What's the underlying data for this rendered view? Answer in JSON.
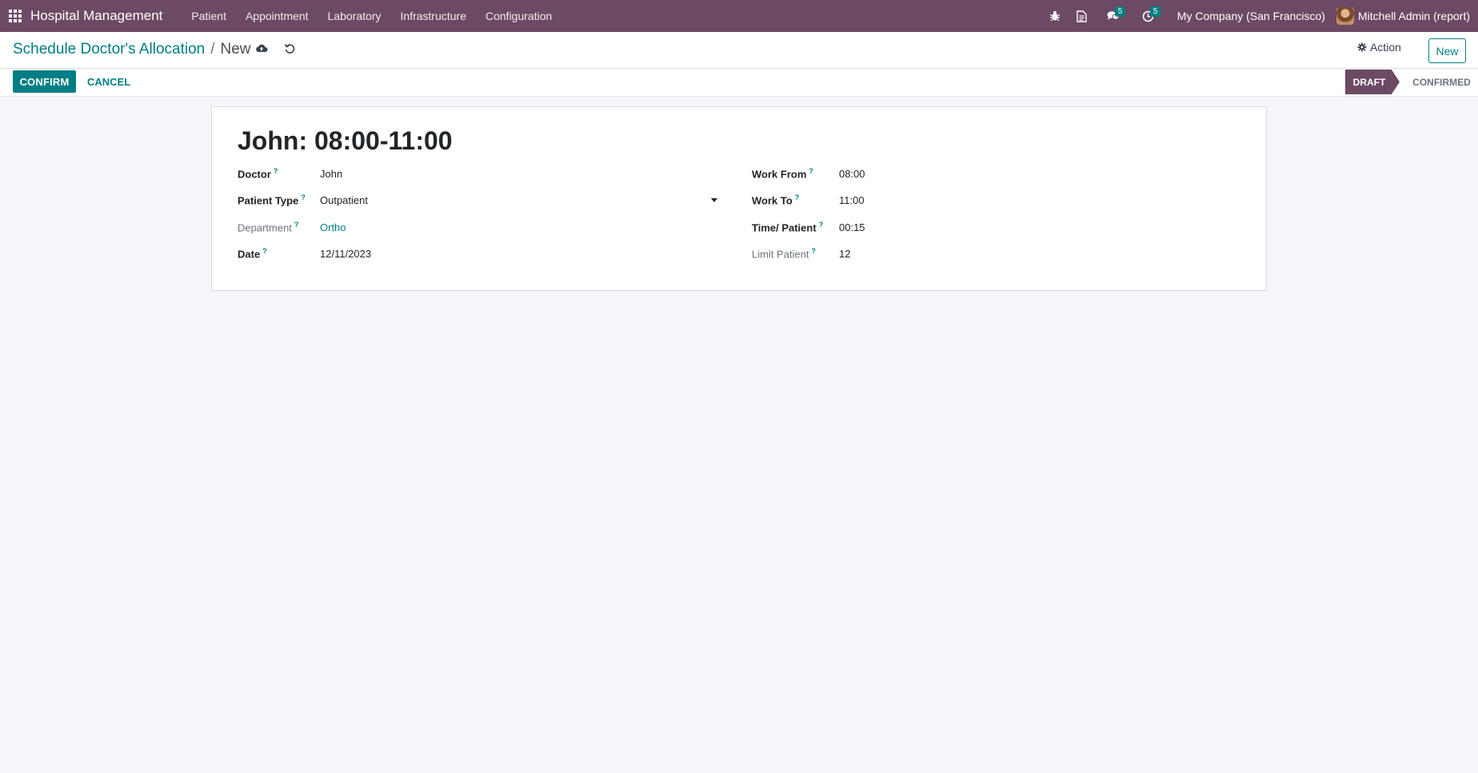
{
  "navbar": {
    "app_name": "Hospital Management",
    "menu": [
      "Patient",
      "Appointment",
      "Laboratory",
      "Infrastructure",
      "Configuration"
    ],
    "messages_count": "5",
    "activities_count": "5",
    "company": "My Company (San Francisco)",
    "user": "Mitchell Admin (report)"
  },
  "breadcrumb": {
    "parent": "Schedule Doctor's Allocation",
    "separator": "/",
    "current": "New"
  },
  "control": {
    "action_label": "Action",
    "new_label": "New"
  },
  "statusbar": {
    "confirm_label": "CONFIRM",
    "cancel_label": "CANCEL",
    "stages": [
      "DRAFT",
      "CONFIRMED"
    ],
    "active_stage": "DRAFT"
  },
  "form": {
    "title": "John: 08:00-11:00",
    "help_mark": "?",
    "left": [
      {
        "label": "Doctor",
        "value": "John"
      },
      {
        "label": "Patient Type",
        "value": "Outpatient"
      },
      {
        "label": "Department",
        "value": "Ortho"
      },
      {
        "label": "Date",
        "value": "12/11/2023"
      }
    ],
    "right": [
      {
        "label": "Work From",
        "value": "08:00"
      },
      {
        "label": "Work To",
        "value": "11:00"
      },
      {
        "label": "Time/ Patient",
        "value": "00:15"
      },
      {
        "label": "Limit Patient",
        "value": "12"
      }
    ]
  },
  "colors": {
    "navbar": "#6c4a63",
    "accent": "#017e84",
    "background": "#f5f6f9"
  }
}
